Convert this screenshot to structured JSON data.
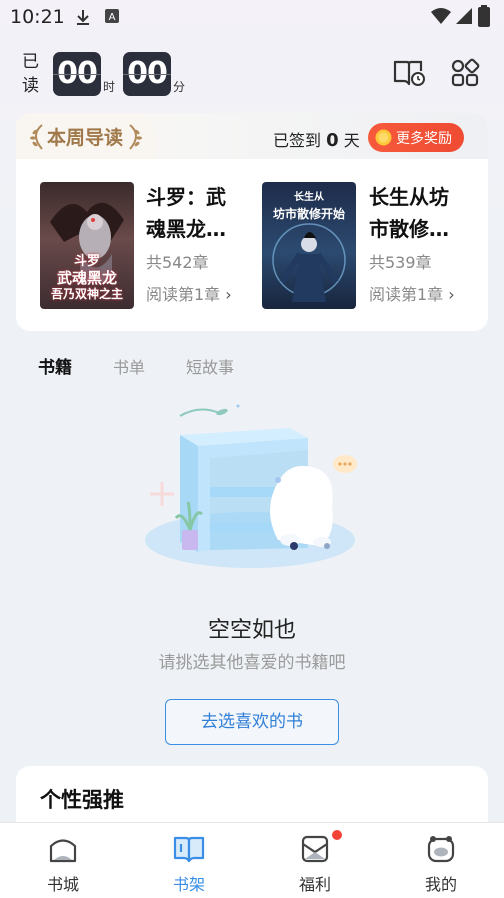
{
  "status_bar": {
    "time": "10:21"
  },
  "reading_timer": {
    "label_line1": "已",
    "label_line2": "读",
    "hours": "00",
    "hours_unit": "时",
    "minutes": "00",
    "minutes_unit": "分"
  },
  "weekly_guide": {
    "title": "本周导读",
    "checkin_prefix": "已签到",
    "checkin_days": "0",
    "checkin_suffix": "天",
    "rewards_button": "更多奖励",
    "books": [
      {
        "title_line1": "斗罗：武",
        "title_line2": "魂黑龙…",
        "chapters": "共542章",
        "read_action": "阅读第1章",
        "cover_text_top": "斗罗",
        "cover_text_mid": "武魂黑龙",
        "cover_text_bottom": "吾乃双神之主"
      },
      {
        "title_line1": "长生从坊",
        "title_line2": "市散修…",
        "chapters": "共539章",
        "read_action": "阅读第1章",
        "cover_text_top": "长生从",
        "cover_text_mid": "坊市散修开始"
      }
    ]
  },
  "shelf_tabs": [
    {
      "label": "书籍",
      "active": true
    },
    {
      "label": "书单",
      "active": false
    },
    {
      "label": "短故事",
      "active": false
    }
  ],
  "empty_state": {
    "title": "空空如也",
    "subtitle": "请挑选其他喜爱的书籍吧",
    "button": "去选喜欢的书"
  },
  "recommend": {
    "title": "个性强推"
  },
  "bottom_nav": [
    {
      "label": "书城",
      "icon": "bookstore-icon",
      "active": false
    },
    {
      "label": "书架",
      "icon": "bookshelf-icon",
      "active": true
    },
    {
      "label": "福利",
      "icon": "welfare-icon",
      "active": false,
      "badge": true
    },
    {
      "label": "我的",
      "icon": "profile-icon",
      "active": false
    }
  ],
  "colors": {
    "accent": "#3a8ee6",
    "reward": "#f0583a",
    "timer_bg": "#2b2f3c",
    "badge": "#f44336"
  }
}
